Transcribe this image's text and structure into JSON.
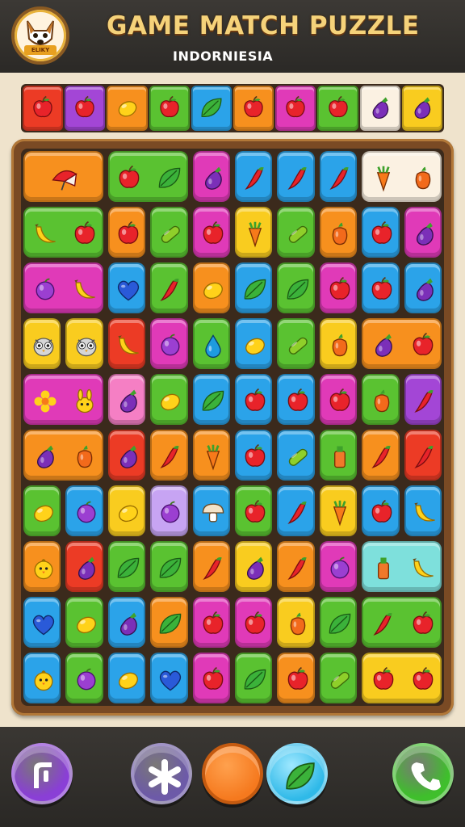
{
  "header": {
    "title": "GAME MATCH PUZZLE",
    "subtitle": "INDORNIESIA",
    "logo_icon": "dog-mascot-icon",
    "logo_badge_text": "ELIKY"
  },
  "palette": {
    "red": "#ec3b25",
    "orange": "#f7901e",
    "yellow": "#f9cc1f",
    "green": "#5ac231",
    "blue": "#2ba3e9",
    "purple": "#a346d6",
    "magenta": "#e03ab8",
    "pink": "#f57fc4",
    "cream": "#fbf1e2",
    "lavender": "#c7a4f3",
    "teal": "#7ee0dc"
  },
  "top_strip": [
    {
      "color": "red",
      "icon": "apple-icon"
    },
    {
      "color": "purple",
      "icon": "apple-icon"
    },
    {
      "color": "orange",
      "icon": "lemon-icon"
    },
    {
      "color": "green",
      "icon": "apple-icon"
    },
    {
      "color": "blue",
      "icon": "leaf-icon"
    },
    {
      "color": "orange",
      "icon": "apple-icon"
    },
    {
      "color": "magenta",
      "icon": "apple-icon"
    },
    {
      "color": "green",
      "icon": "apple-icon"
    },
    {
      "color": "cream",
      "icon": "eggplant-icon"
    },
    {
      "color": "yellow",
      "icon": "eggplant-icon"
    }
  ],
  "board": {
    "rows": [
      [
        {
          "span": 2,
          "color": "orange",
          "icon": "umbrella-icon"
        },
        {
          "span": 2,
          "color": "green",
          "icons": [
            "apple-icon",
            "leaf-icon"
          ]
        },
        {
          "span": 1,
          "color": "magenta",
          "icon": "eggplant-icon"
        },
        {
          "span": 1,
          "color": "blue",
          "icon": "chili-icon"
        },
        {
          "span": 1,
          "color": "blue",
          "icon": "chili-icon"
        },
        {
          "span": 1,
          "color": "blue",
          "icon": "chili-icon"
        },
        {
          "span": 2,
          "color": "cream",
          "icons": [
            "carrot-icon",
            "pepper-icon"
          ]
        }
      ],
      [
        {
          "span": 2,
          "color": "green",
          "icons": [
            "banana-icon",
            "apple-icon"
          ]
        },
        {
          "span": 1,
          "color": "orange",
          "icon": "apple-icon"
        },
        {
          "span": 1,
          "color": "green",
          "icon": "cucumber-icon"
        },
        {
          "span": 1,
          "color": "magenta",
          "icon": "apple-icon"
        },
        {
          "span": 1,
          "color": "yellow",
          "icon": "carrot-icon"
        },
        {
          "span": 1,
          "color": "green",
          "icon": "cucumber-icon"
        },
        {
          "span": 1,
          "color": "orange",
          "icon": "pepper-icon"
        },
        {
          "span": 1,
          "color": "blue",
          "icon": "apple-icon"
        },
        {
          "span": 1,
          "color": "magenta",
          "icon": "eggplant-icon"
        }
      ],
      [
        {
          "span": 2,
          "color": "magenta",
          "icons": [
            "plum-icon",
            "banana-icon"
          ]
        },
        {
          "span": 1,
          "color": "blue",
          "icon": "heart-icon"
        },
        {
          "span": 1,
          "color": "green",
          "icon": "chili-icon"
        },
        {
          "span": 1,
          "color": "orange",
          "icon": "lemon-icon"
        },
        {
          "span": 1,
          "color": "blue",
          "icon": "leaf-icon"
        },
        {
          "span": 1,
          "color": "green",
          "icon": "leaf-icon"
        },
        {
          "span": 1,
          "color": "magenta",
          "icon": "apple-icon"
        },
        {
          "span": 1,
          "color": "blue",
          "icon": "apple-icon"
        },
        {
          "span": 1,
          "color": "blue",
          "icon": "eggplant-icon"
        }
      ],
      [
        {
          "span": 1,
          "color": "yellow",
          "icon": "owl-icon"
        },
        {
          "span": 1,
          "color": "yellow",
          "icon": "owl-icon"
        },
        {
          "span": 1,
          "color": "red",
          "icon": "banana-icon"
        },
        {
          "span": 1,
          "color": "magenta",
          "icon": "plum-icon"
        },
        {
          "span": 1,
          "color": "green",
          "icon": "drop-icon"
        },
        {
          "span": 1,
          "color": "blue",
          "icon": "lemon-icon"
        },
        {
          "span": 1,
          "color": "green",
          "icon": "cucumber-icon"
        },
        {
          "span": 1,
          "color": "yellow",
          "icon": "pepper-icon"
        },
        {
          "span": 2,
          "color": "orange",
          "icons": [
            "eggplant-icon",
            "apple-icon"
          ]
        }
      ],
      [
        {
          "span": 2,
          "color": "magenta",
          "icons": [
            "flower-icon",
            "bunny-icon"
          ]
        },
        {
          "span": 1,
          "color": "pink",
          "icon": "eggplant-icon"
        },
        {
          "span": 1,
          "color": "green",
          "icon": "lemon-icon"
        },
        {
          "span": 1,
          "color": "blue",
          "icon": "leaf-icon"
        },
        {
          "span": 1,
          "color": "blue",
          "icon": "apple-icon"
        },
        {
          "span": 1,
          "color": "blue",
          "icon": "apple-icon"
        },
        {
          "span": 1,
          "color": "magenta",
          "icon": "apple-icon"
        },
        {
          "span": 1,
          "color": "green",
          "icon": "pepper-icon"
        },
        {
          "span": 1,
          "color": "purple",
          "icon": "chili-icon"
        }
      ],
      [
        {
          "span": 2,
          "color": "orange",
          "icons": [
            "eggplant-icon",
            "pepper-icon"
          ]
        },
        {
          "span": 1,
          "color": "red",
          "icon": "eggplant-icon"
        },
        {
          "span": 1,
          "color": "orange",
          "icon": "chili-icon"
        },
        {
          "span": 1,
          "color": "orange",
          "icon": "carrot-icon"
        },
        {
          "span": 1,
          "color": "blue",
          "icon": "apple-icon"
        },
        {
          "span": 1,
          "color": "blue",
          "icon": "cucumber-icon"
        },
        {
          "span": 1,
          "color": "green",
          "icon": "bottle-icon"
        },
        {
          "span": 1,
          "color": "orange",
          "icon": "chili-icon"
        },
        {
          "span": 1,
          "color": "red",
          "icon": "chili-icon"
        }
      ],
      [
        {
          "span": 1,
          "color": "green",
          "icon": "lemon-icon"
        },
        {
          "span": 1,
          "color": "blue",
          "icon": "plum-icon"
        },
        {
          "span": 1,
          "color": "yellow",
          "icon": "lemon-icon"
        },
        {
          "span": 1,
          "color": "lavender",
          "icon": "plum-icon"
        },
        {
          "span": 1,
          "color": "blue",
          "icon": "mushroom-icon"
        },
        {
          "span": 1,
          "color": "green",
          "icon": "apple-icon"
        },
        {
          "span": 1,
          "color": "blue",
          "icon": "chili-icon"
        },
        {
          "span": 1,
          "color": "yellow",
          "icon": "carrot-icon"
        },
        {
          "span": 1,
          "color": "blue",
          "icon": "apple-icon"
        },
        {
          "span": 1,
          "color": "blue",
          "icon": "banana-icon"
        }
      ],
      [
        {
          "span": 1,
          "color": "orange",
          "icon": "chick-icon"
        },
        {
          "span": 1,
          "color": "red",
          "icon": "eggplant-icon"
        },
        {
          "span": 1,
          "color": "green",
          "icon": "leaf-icon"
        },
        {
          "span": 1,
          "color": "green",
          "icon": "leaf-icon"
        },
        {
          "span": 1,
          "color": "orange",
          "icon": "chili-icon"
        },
        {
          "span": 1,
          "color": "yellow",
          "icon": "eggplant-icon"
        },
        {
          "span": 1,
          "color": "orange",
          "icon": "chili-icon"
        },
        {
          "span": 1,
          "color": "magenta",
          "icon": "plum-icon"
        },
        {
          "span": 2,
          "color": "teal",
          "icons": [
            "bottle-icon",
            "banana-icon"
          ]
        }
      ],
      [
        {
          "span": 1,
          "color": "blue",
          "icon": "heart-icon"
        },
        {
          "span": 1,
          "color": "green",
          "icon": "lemon-icon"
        },
        {
          "span": 1,
          "color": "blue",
          "icon": "eggplant-icon"
        },
        {
          "span": 1,
          "color": "orange",
          "icon": "leaf-icon"
        },
        {
          "span": 1,
          "color": "magenta",
          "icon": "apple-icon"
        },
        {
          "span": 1,
          "color": "magenta",
          "icon": "apple-icon"
        },
        {
          "span": 1,
          "color": "yellow",
          "icon": "pepper-icon"
        },
        {
          "span": 1,
          "color": "green",
          "icon": "leaf-icon"
        },
        {
          "span": 2,
          "color": "green",
          "icons": [
            "chili-icon",
            "apple-icon"
          ]
        }
      ],
      [
        {
          "span": 1,
          "color": "blue",
          "icon": "chick-icon"
        },
        {
          "span": 1,
          "color": "green",
          "icon": "plum-icon"
        },
        {
          "span": 1,
          "color": "blue",
          "icon": "lemon-icon"
        },
        {
          "span": 1,
          "color": "blue",
          "icon": "heart-icon"
        },
        {
          "span": 1,
          "color": "magenta",
          "icon": "apple-icon"
        },
        {
          "span": 1,
          "color": "green",
          "icon": "leaf-icon"
        },
        {
          "span": 1,
          "color": "orange",
          "icon": "apple-icon"
        },
        {
          "span": 1,
          "color": "green",
          "icon": "cucumber-icon"
        },
        {
          "span": 2,
          "color": "yellow",
          "icons": [
            "apple-icon",
            "apple-icon"
          ]
        }
      ]
    ]
  },
  "footer": {
    "buttons": [
      {
        "name": "hint-button",
        "icon": "hint-icon",
        "color": "#8a3fd6"
      },
      {
        "name": "shuffle-button",
        "icon": "asterisk-icon",
        "color": "#6d5aa8"
      },
      {
        "name": "orange-action-button",
        "icon": "orange-dot-icon",
        "color": "#f5791e"
      },
      {
        "name": "leaf-button",
        "icon": "leaf-icon",
        "color": "#2fb9e8"
      },
      {
        "name": "call-button",
        "icon": "phone-icon",
        "color": "#3fbf2c"
      }
    ]
  }
}
